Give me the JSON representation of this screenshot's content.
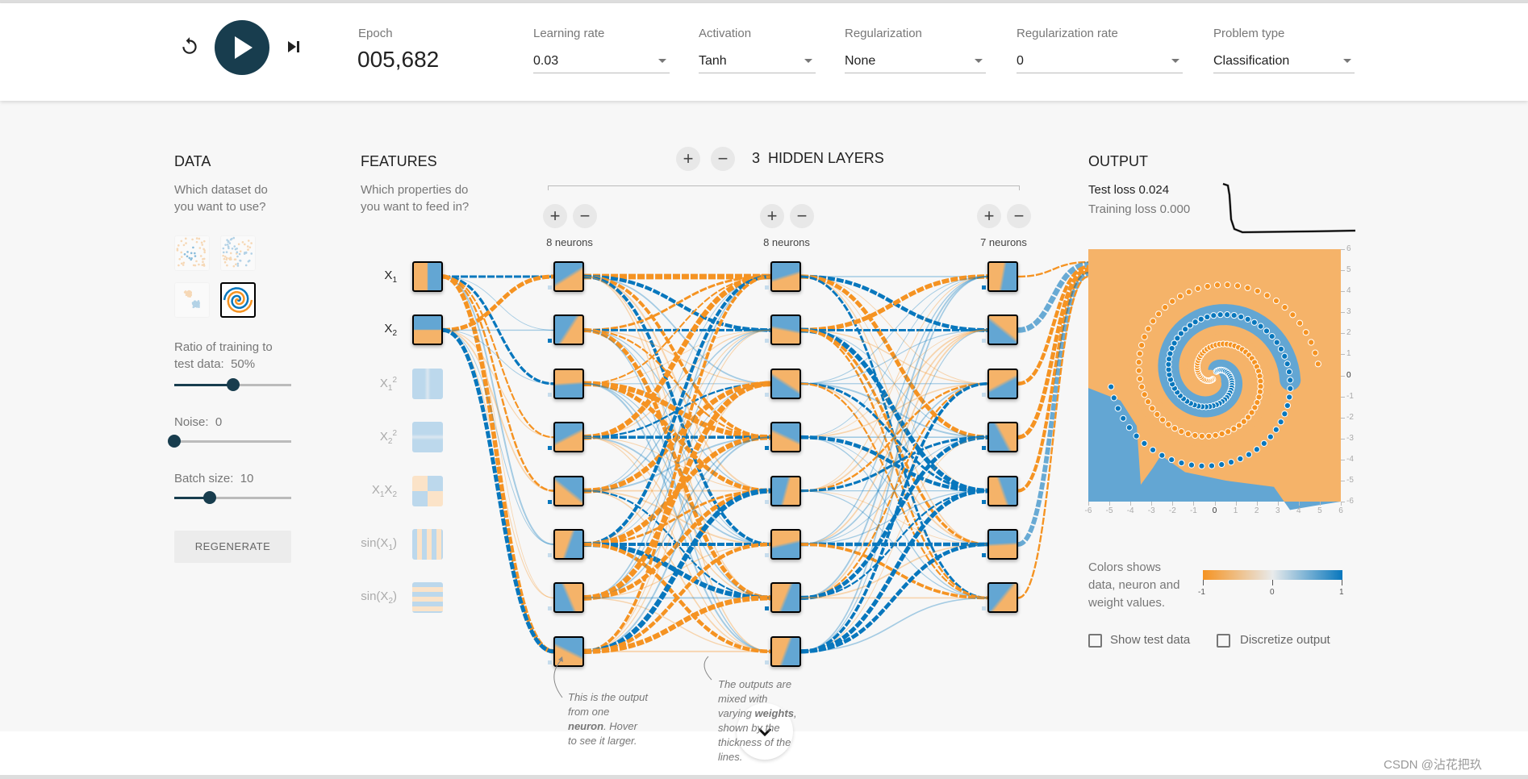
{
  "header": {
    "reset_icon": "reset-icon",
    "play_icon": "play-icon",
    "step_icon": "step-icon",
    "epoch_label": "Epoch",
    "epoch_value": "005,682",
    "controls": [
      {
        "label": "Learning rate",
        "value": "0.03"
      },
      {
        "label": "Activation",
        "value": "Tanh"
      },
      {
        "label": "Regularization",
        "value": "None"
      },
      {
        "label": "Regularization rate",
        "value": "0"
      },
      {
        "label": "Problem type",
        "value": "Classification"
      }
    ]
  },
  "data_panel": {
    "title": "DATA",
    "question": "Which dataset do you want to use?",
    "datasets": [
      "circle",
      "xor",
      "gaussian",
      "spiral"
    ],
    "selected_dataset": "spiral",
    "ratio_label": "Ratio of training to test data:",
    "ratio_value": "50%",
    "ratio_fraction": 0.5,
    "noise_label": "Noise:",
    "noise_value": "0",
    "noise_fraction": 0,
    "batch_label": "Batch size:",
    "batch_value": "10",
    "batch_fraction": 0.3,
    "regenerate": "REGENERATE"
  },
  "features": {
    "title": "FEATURES",
    "question": "Which properties do you want to feed in?",
    "items": [
      {
        "parts": [
          {
            "t": "X",
            "sub": "1"
          }
        ],
        "active": true
      },
      {
        "parts": [
          {
            "t": "X",
            "sub": "2"
          }
        ],
        "active": true
      },
      {
        "parts": [
          {
            "t": "X",
            "sub": "1",
            "sup": "2"
          }
        ],
        "active": false
      },
      {
        "parts": [
          {
            "t": "X",
            "sub": "2",
            "sup": "2"
          }
        ],
        "active": false
      },
      {
        "parts": [
          {
            "t": "X",
            "sub": "1"
          },
          {
            "t": "X",
            "sub": "2"
          }
        ],
        "active": false
      },
      {
        "parts": [
          {
            "t": "sin(X",
            "sub": "1"
          },
          {
            "t": ")"
          }
        ],
        "active": false
      },
      {
        "parts": [
          {
            "t": "sin(X",
            "sub": "2"
          },
          {
            "t": ")"
          }
        ],
        "active": false
      }
    ]
  },
  "network": {
    "add": "+",
    "remove": "−",
    "hidden_layers_count": "3",
    "hidden_layers_label": "HIDDEN LAYERS",
    "layers": [
      {
        "neurons_label": "8 neurons"
      },
      {
        "neurons_label": "8 neurons"
      },
      {
        "neurons_label": "7 neurons"
      }
    ],
    "annotation_neuron": [
      "This is the output",
      "from one",
      "neuron",
      ". Hover",
      "to see it larger."
    ],
    "annotation_weights": [
      "The outputs are",
      "mixed with",
      "varying ",
      "weights",
      ",",
      "shown by the",
      "thickness of the",
      "lines."
    ]
  },
  "output": {
    "title": "OUTPUT",
    "test_loss": "Test loss 0.024",
    "training_loss": "Training loss 0.000",
    "x_ticks": [
      "-6",
      "-5",
      "-4",
      "-3",
      "-2",
      "-1",
      "0",
      "1",
      "2",
      "3",
      "4",
      "5",
      "6"
    ],
    "y_ticks": [
      "6",
      "5",
      "4",
      "3",
      "2",
      "1",
      "0",
      "-1",
      "-2",
      "-3",
      "-4",
      "-5",
      "-6"
    ],
    "legend_text": [
      "Colors shows",
      "data, neuron and",
      "weight values."
    ],
    "legend_ticks": [
      "-1",
      "0",
      "1"
    ],
    "show_test_data": "Show test data",
    "discretize": "Discretize output",
    "show_test_checked": false,
    "discretize_checked": false
  },
  "colors": {
    "orange": "#f59322",
    "blue": "#0877bd",
    "light_orange": "#f5b369",
    "light_blue": "#63a6d3",
    "dark": "#183d4e"
  },
  "watermark": "CSDN @沾花把玖"
}
